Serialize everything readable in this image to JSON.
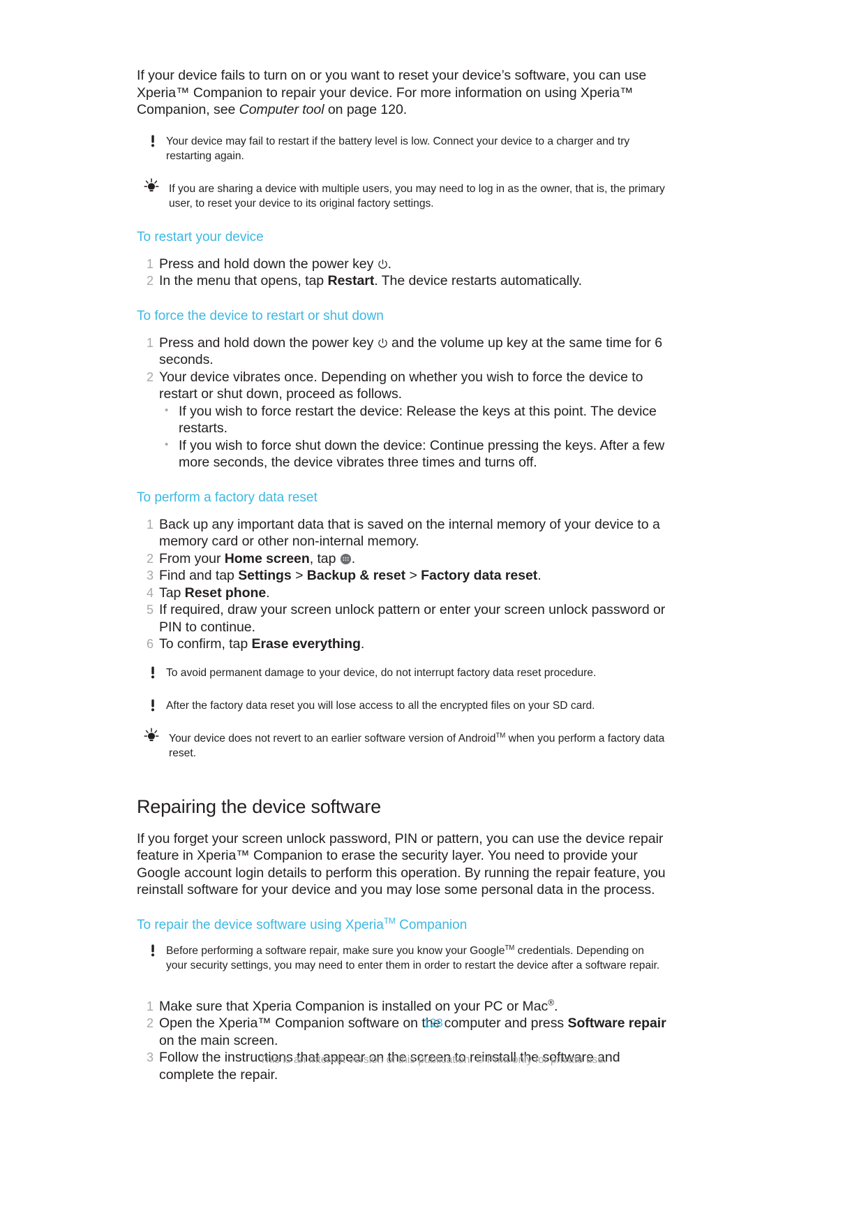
{
  "document": {
    "page_number": "128",
    "footer_text": "This is an Internet version of this publication. © Print only for private use.",
    "accent_color": "#3cb8e2",
    "text_color": "#231f20",
    "muted_color": "#a8a8a8"
  },
  "intro": {
    "part1": "If your device fails to turn on or you want to reset your device’s software, you can use Xperia™ Companion to repair your device. For more information on using Xperia™ Companion, see ",
    "italic_ref": "Computer tool",
    "part2": " on page 120."
  },
  "notes": {
    "battery_warning": {
      "icon": "warning-exclamation-icon",
      "text": "Your device may fail to restart if the battery level is low. Connect your device to a charger and try restarting again."
    },
    "multi_user_tip": {
      "icon": "tip-lightbulb-icon",
      "text": "If you are sharing a device with multiple users, you may need to log in as the owner, that is, the primary user, to reset your device to its original factory settings."
    },
    "no_interrupt_warning": {
      "icon": "warning-exclamation-icon",
      "text": "To avoid permanent damage to your device, do not interrupt factory data reset procedure."
    },
    "sd_card_warning": {
      "icon": "warning-exclamation-icon",
      "text": "After the factory data reset you will lose access to all the encrypted files on your SD card."
    },
    "android_version_tip": {
      "icon": "tip-lightbulb-icon",
      "text_part1": "Your device does not revert to an earlier software version of Android",
      "tm": "TM",
      "text_part2": " when you perform a factory data reset."
    },
    "google_credentials_warning": {
      "icon": "warning-exclamation-icon",
      "text_part1": "Before performing a software repair, make sure you know your Google",
      "tm": "TM",
      "text_part2": " credentials. Depending on your security settings, you may need to enter them in order to restart the device after a software repair."
    }
  },
  "sections": {
    "restart_device": {
      "heading": "To restart your device",
      "steps": [
        {
          "pre": "Press and hold down the power key ",
          "icon": "power-key-icon",
          "post": "."
        },
        {
          "pre": "In the menu that opens, tap ",
          "bold": "Restart",
          "post": ". The device restarts automatically."
        }
      ]
    },
    "force_restart": {
      "heading": "To force the device to restart or shut down",
      "steps": [
        {
          "pre": "Press and hold down the power key ",
          "icon": "power-key-icon",
          "post": " and the volume up key at the same time for 6 seconds."
        },
        {
          "pre": "Your device vibrates once. Depending on whether you wish to force the device to restart or shut down, proceed as follows."
        }
      ],
      "sub_bullets": [
        "If you wish to force restart the device: Release the keys at this point. The device restarts.",
        "If you wish to force shut down the device: Continue pressing the keys. After a few more seconds, the device vibrates three times and turns off."
      ]
    },
    "factory_reset": {
      "heading": "To perform a factory data reset",
      "steps": [
        {
          "pre": "Back up any important data that is saved on the internal memory of your device to a memory card or other non-internal memory."
        },
        {
          "pre": "From your ",
          "bold": "Home screen",
          "mid": ", tap ",
          "icon": "app-drawer-icon",
          "post": "."
        },
        {
          "pre": "Find and tap ",
          "bold": "Settings",
          "sep1": " > ",
          "bold2": "Backup & reset",
          "sep2": " > ",
          "bold3": "Factory data reset",
          "post": "."
        },
        {
          "pre": "Tap ",
          "bold": "Reset phone",
          "post": "."
        },
        {
          "pre": "If required, draw your screen unlock pattern or enter your screen unlock password or PIN to continue."
        },
        {
          "pre": "To confirm, tap ",
          "bold": "Erase everything",
          "post": "."
        }
      ]
    },
    "repairing": {
      "heading": "Repairing the device software",
      "paragraph": "If you forget your screen unlock password, PIN or pattern, you can use the device repair feature in Xperia™ Companion to erase the security layer. You need to provide your Google account login details to perform this operation. By running the repair feature, you reinstall software for your device and you may lose some personal data in the process.",
      "subheading_part1": "To repair the device software using Xperia",
      "subheading_tm": "TM",
      "subheading_part2": " Companion",
      "steps": [
        {
          "pre": "Make sure that Xperia Companion is installed on your PC or Mac",
          "sup": "®",
          "post": "."
        },
        {
          "pre": "Open the Xperia™ Companion software on the computer and press ",
          "bold": "Software repair",
          "post": " on the main screen."
        },
        {
          "pre": "Follow the instructions that appear on the screen to reinstall the software and complete the repair."
        }
      ]
    }
  }
}
